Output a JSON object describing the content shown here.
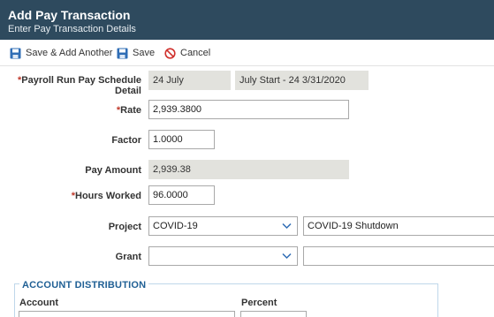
{
  "header": {
    "title": "Add Pay Transaction",
    "subtitle": "Enter Pay Transaction Details"
  },
  "toolbar": {
    "save_add_another_label": "Save & Add Another",
    "save_label": "Save",
    "cancel_label": "Cancel"
  },
  "form": {
    "payroll_schedule": {
      "label": "Payroll Run Pay Schedule Detail",
      "required_mark": "*",
      "value": "24 July",
      "detail": "July Start - 24 3/31/2020"
    },
    "rate": {
      "label": "Rate",
      "required_mark": "*",
      "value": "2,939.3800"
    },
    "factor": {
      "label": "Factor",
      "value": "1.0000"
    },
    "pay_amount": {
      "label": "Pay Amount",
      "value": "2,939.38"
    },
    "hours_worked": {
      "label": "Hours Worked",
      "required_mark": "*",
      "value": "96.0000"
    },
    "project": {
      "label": "Project",
      "value": "COVID-19",
      "description": "COVID-19 Shutdown"
    },
    "grant": {
      "label": "Grant",
      "value": "",
      "description": ""
    }
  },
  "account_distribution": {
    "title": "ACCOUNT DISTRIBUTION",
    "col_account": "Account",
    "col_percent": "Percent"
  },
  "colors": {
    "titlebar": "#2e4a5e",
    "required": "#c0392b",
    "readonly_bg": "#e2e2dd",
    "section_title": "#1f5f94",
    "save_icon": "#2f6db5",
    "cancel_icon": "#d0312d"
  }
}
